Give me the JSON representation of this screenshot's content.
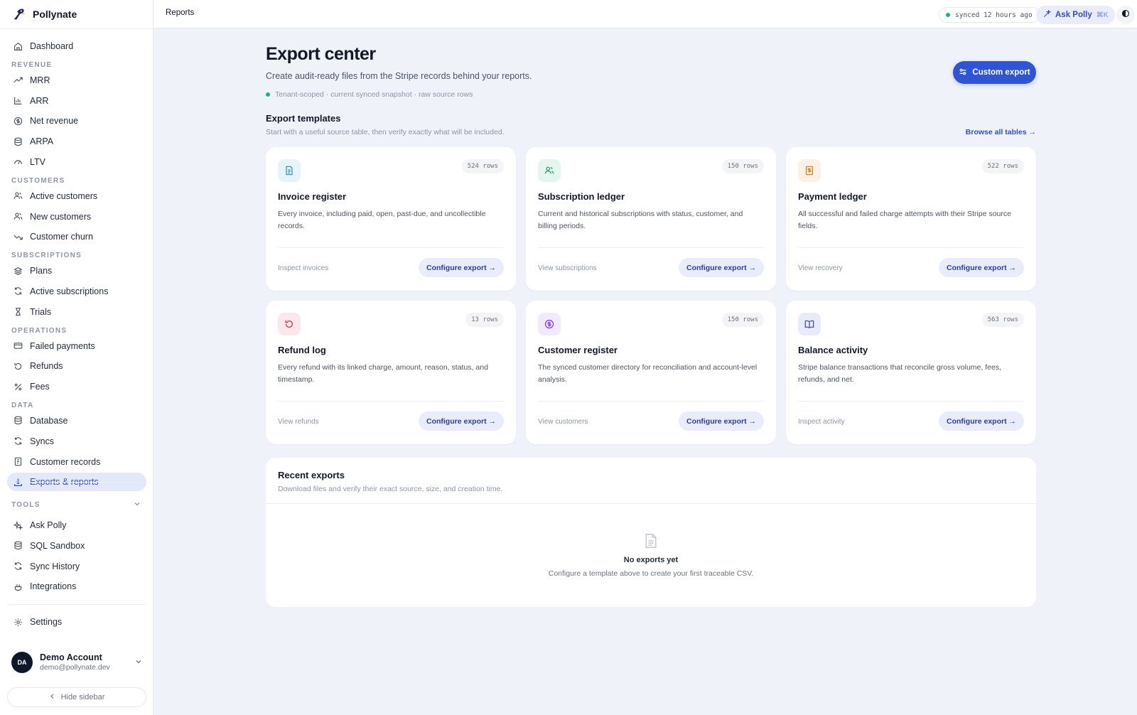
{
  "app": {
    "name": "Pollynate"
  },
  "topbar": {
    "breadcrumb": "Reports",
    "sync_status": "synced 12 hours ago",
    "ask_label": "Ask Polly",
    "ask_shortcut": "⌘K"
  },
  "sidebar": {
    "dashboard": "Dashboard",
    "sections": {
      "revenue": "REVENUE",
      "customers": "CUSTOMERS",
      "subscriptions": "SUBSCRIPTIONS",
      "operations": "OPERATIONS",
      "data": "DATA",
      "tools": "TOOLS"
    },
    "revenue": [
      "MRR",
      "ARR",
      "Net revenue",
      "ARPA",
      "LTV"
    ],
    "customers": [
      "Active customers",
      "New customers",
      "Customer churn"
    ],
    "subscriptions": [
      "Plans",
      "Active subscriptions",
      "Trials"
    ],
    "operations": [
      "Failed payments",
      "Refunds",
      "Fees"
    ],
    "data": [
      "Database",
      "Syncs",
      "Customer records",
      "Exports & reports"
    ],
    "tools": [
      "Ask Polly",
      "SQL Sandbox",
      "Sync History",
      "Integrations"
    ],
    "settings": "Settings",
    "account": {
      "initials": "DA",
      "name": "Demo Account",
      "email": "demo@pollynate.dev"
    },
    "hide_label": "Hide sidebar"
  },
  "page": {
    "title": "Export center",
    "subtitle": "Create audit-ready files from the Stripe records behind your reports.",
    "meta": "Tenant-scoped · current synced snapshot · raw source rows",
    "custom_export_label": "Custom export",
    "templates_title": "Export templates",
    "templates_subtitle": "Start with a useful source table, then verify exactly what will be included.",
    "browse_label": "Browse all tables →"
  },
  "templates": [
    {
      "title": "Invoice register",
      "rows": "524 rows",
      "desc": "Every invoice, including paid, open, past-due, and uncollectible records.",
      "link": "Inspect invoices",
      "button": "Configure export →",
      "icon": "document-icon",
      "color": "#2b8fb8",
      "bg": "#e6f4fa"
    },
    {
      "title": "Subscription ledger",
      "rows": "150 rows",
      "desc": "Current and historical subscriptions with status, customer, and billing periods.",
      "link": "View subscriptions",
      "button": "Configure export →",
      "icon": "users-icon",
      "color": "#1f9d6b",
      "bg": "#e5f6ee"
    },
    {
      "title": "Payment ledger",
      "rows": "522 rows",
      "desc": "All successful and failed charge attempts with their Stripe source fields.",
      "link": "View recovery",
      "button": "Configure export →",
      "icon": "dollar-receipt-icon",
      "color": "#e07a1f",
      "bg": "#fdf0e4"
    },
    {
      "title": "Refund log",
      "rows": "13 rows",
      "desc": "Every refund with its linked charge, amount, reason, status, and timestamp.",
      "link": "View refunds",
      "button": "Configure export →",
      "icon": "refund-icon",
      "color": "#d6334a",
      "bg": "#fce8ec"
    },
    {
      "title": "Customer register",
      "rows": "150 rows",
      "desc": "The synced customer directory for reconciliation and account-level analysis.",
      "link": "View customers",
      "button": "Configure export →",
      "icon": "dollar-circle-icon",
      "color": "#7c3aed",
      "bg": "#f1eafd"
    },
    {
      "title": "Balance activity",
      "rows": "563 rows",
      "desc": "Stripe balance transactions that reconcile gross volume, fees, refunds, and net.",
      "link": "Inspect activity",
      "button": "Configure export →",
      "icon": "book-icon",
      "color": "#3d4fb8",
      "bg": "#e8ebf8"
    }
  ],
  "recent": {
    "title": "Recent exports",
    "subtitle": "Download files and verify their exact source, size, and creation time.",
    "empty_title": "No exports yet",
    "empty_subtitle": "Configure a template above to create your first traceable CSV."
  }
}
